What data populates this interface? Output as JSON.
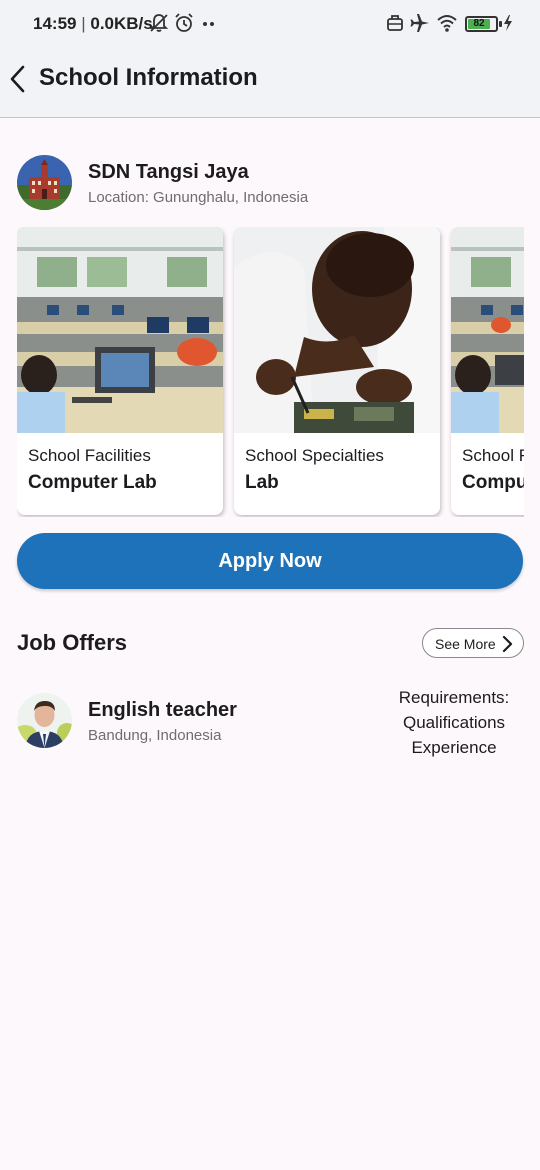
{
  "status_bar": {
    "time": "14:59",
    "separator": "|",
    "speed": "0.0KB/s",
    "battery": "82"
  },
  "app_bar": {
    "title": "School Information"
  },
  "school": {
    "name": "SDN Tangsi Jaya",
    "location": "Location: Gununghalu, Indonesia"
  },
  "cards": [
    {
      "category": "School Facilities",
      "value": "Computer Lab"
    },
    {
      "category": "School Specialties",
      "value": "Lab"
    },
    {
      "category": "School Facilities",
      "value": "Computer Lab"
    }
  ],
  "apply_button": "Apply Now",
  "job_offers": {
    "title": "Job Offers",
    "see_more": "See More",
    "items": [
      {
        "title": "English teacher",
        "location": "Bandung, Indonesia",
        "requirements_label": "Requirements:",
        "requirements": [
          "Qualifications",
          "Experience"
        ]
      }
    ]
  },
  "colors": {
    "primary": "#1e72b9",
    "background": "#fdf8fc",
    "app_bar": "#f2f3f7",
    "battery": "#4caf50"
  }
}
